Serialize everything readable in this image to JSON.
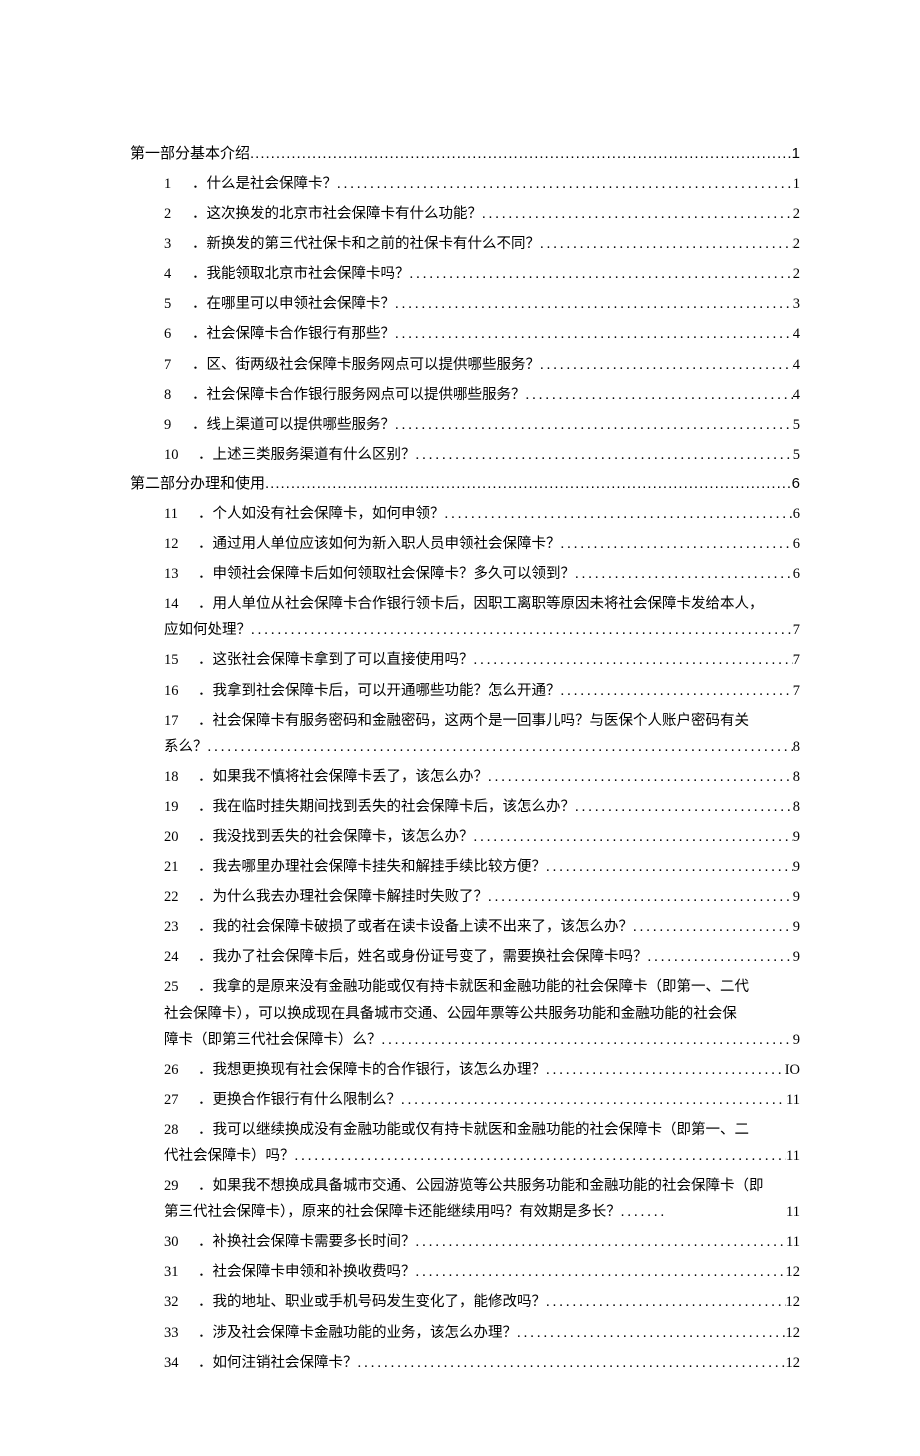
{
  "sections": [
    {
      "title": "第一部分基本介绍",
      "page": "1"
    },
    {
      "title": "第二部分办理和使用",
      "page": "6"
    }
  ],
  "section1_items": [
    {
      "num": "1",
      "label": "．什么是社会保障卡？",
      "page": "1"
    },
    {
      "num": "2",
      "label": "．这次换发的北京市社会保障卡有什么功能？",
      "page": "2"
    },
    {
      "num": "3",
      "label": "．新换发的第三代社保卡和之前的社保卡有什么不同？",
      "page": "2"
    },
    {
      "num": "4",
      "label": "．我能领取北京市社会保障卡吗？",
      "page": "2"
    },
    {
      "num": "5",
      "label": "．在哪里可以申领社会保障卡？",
      "page": "3"
    },
    {
      "num": "6",
      "label": "．社会保障卡合作银行有那些？",
      "page": "4"
    },
    {
      "num": "7",
      "label": "．区、街两级社会保障卡服务网点可以提供哪些服务？",
      "page": "4"
    },
    {
      "num": "8",
      "label": "．社会保障卡合作银行服务网点可以提供哪些服务？",
      "page": "4"
    },
    {
      "num": "9",
      "label": "．线上渠道可以提供哪些服务？",
      "page": "5"
    },
    {
      "num": "10",
      "label": "．上述三类服务渠道有什么区别？",
      "page": "5"
    }
  ],
  "section2_items_a": [
    {
      "num": "11",
      "label": "．个人如没有社会保障卡，如何申领？",
      "page": "6"
    },
    {
      "num": "12",
      "label": "．通过用人单位应该如何为新入职人员申领社会保障卡？",
      "page": "6"
    },
    {
      "num": "13",
      "label": "．申领社会保障卡后如何领取社会保障卡？多久可以领到？",
      "page": "6"
    }
  ],
  "item14": {
    "num": "14",
    "line1": "．用人单位从社会保障卡合作银行领卡后，因职工离职等原因未将社会保障卡发给本人，",
    "tail_lead": "应如何处理？",
    "page": "7"
  },
  "section2_items_b": [
    {
      "num": "15",
      "label": "．这张社会保障卡拿到了可以直接使用吗？",
      "page": "7"
    },
    {
      "num": "16",
      "label": "．我拿到社会保障卡后，可以开通哪些功能？怎么开通？",
      "page": "7"
    }
  ],
  "item17": {
    "num": "17",
    "line1": "．社会保障卡有服务密码和金融密码，这两个是一回事儿吗？与医保个人账户密码有关",
    "tail_lead": "系么？",
    "page": "8"
  },
  "section2_items_c": [
    {
      "num": "18",
      "label": "．如果我不慎将社会保障卡丢了，该怎么办？",
      "page": "8"
    },
    {
      "num": "19",
      "label": "．我在临时挂失期间找到丢失的社会保障卡后，该怎么办？",
      "page": "8"
    },
    {
      "num": "20",
      "label": "．我没找到丢失的社会保障卡，该怎么办？",
      "page": "9"
    },
    {
      "num": "21",
      "label": "．我去哪里办理社会保障卡挂失和解挂手续比较方便？",
      "page": "9"
    },
    {
      "num": "22",
      "label": "．为什么我去办理社会保障卡解挂时失败了？",
      "page": "9"
    },
    {
      "num": "23",
      "label": "．我的社会保障卡破损了或者在读卡设备上读不出来了，该怎么办？",
      "page": "9"
    },
    {
      "num": "24",
      "label": "．我办了社会保障卡后，姓名或身份证号变了，需要换社会保障卡吗？",
      "page": "9"
    }
  ],
  "item25": {
    "num": "25",
    "line1": "．我拿的是原来没有金融功能或仅有持卡就医和金融功能的社会保障卡（即第一、二代",
    "line2": "社会保障卡），可以换成现在具备城市交通、公园年票等公共服务功能和金融功能的社会保",
    "tail_lead": "障卡（即第三代社会保障卡）么？",
    "page": "9"
  },
  "section2_items_d": [
    {
      "num": "26",
      "label": "．我想更换现有社会保障卡的合作银行，该怎么办理？",
      "page": "IO"
    },
    {
      "num": "27",
      "label": "．更换合作银行有什么限制么？",
      "page": "11"
    }
  ],
  "item28": {
    "num": "28",
    "line1": "．我可以继续换成没有金融功能或仅有持卡就医和金融功能的社会保障卡（即第一、二",
    "tail_lead": "代社会保障卡）吗？",
    "page": "11"
  },
  "item29": {
    "num": "29",
    "line1": "．如果我不想换成具备城市交通、公园游览等公共服务功能和金融功能的社会保障卡（即",
    "line2": "第三代社会保障卡），原来的社会保障卡还能继续用吗？有效期是多长？",
    "trail": "11"
  },
  "section2_items_e": [
    {
      "num": "30",
      "label": "．补换社会保障卡需要多长时间？",
      "page": "11"
    },
    {
      "num": "31",
      "label": "．社会保障卡申领和补换收费吗？",
      "page": "12"
    },
    {
      "num": "32",
      "label": "．我的地址、职业或手机号码发生变化了，能修改吗？",
      "page": "12"
    },
    {
      "num": "33",
      "label": "．涉及社会保障卡金融功能的业务，该怎么办理？",
      "page": "12"
    },
    {
      "num": "34",
      "label": "．如何注销社会保障卡？",
      "page": "12"
    }
  ],
  "dotfill": "...................................................................................................................."
}
